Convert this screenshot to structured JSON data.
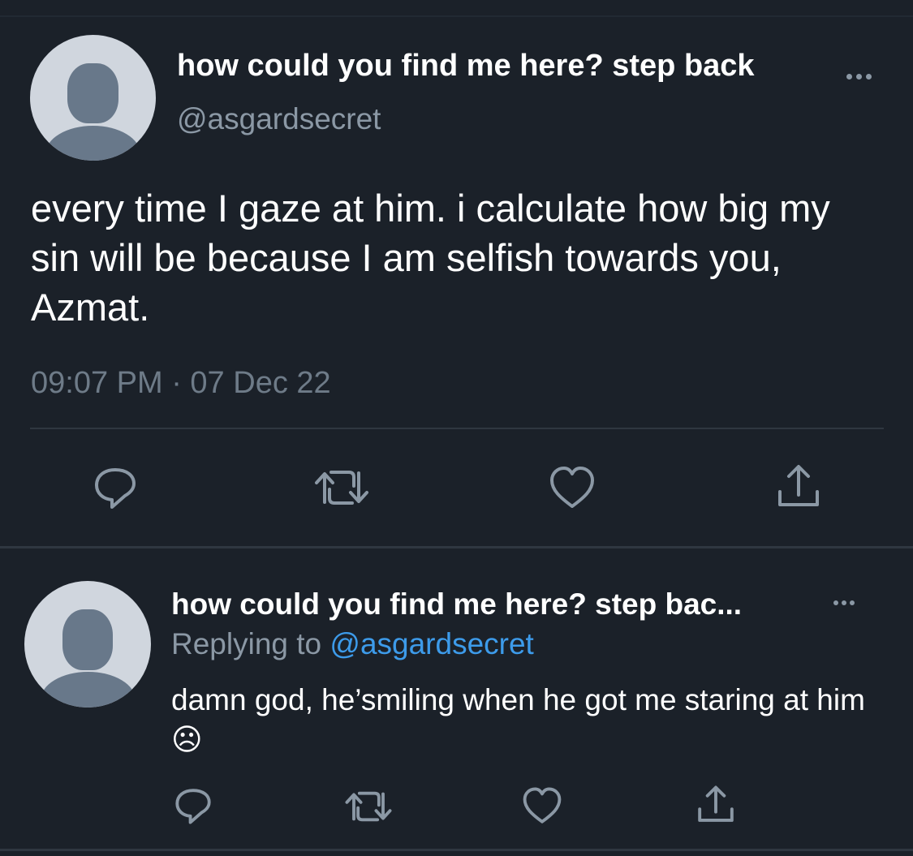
{
  "colors": {
    "background": "#1b2129",
    "text_primary": "#ffffff",
    "text_secondary": "#8b98a5",
    "link": "#3d9bea",
    "icon": "#8b98a5",
    "divider": "#2f3740"
  },
  "main_tweet": {
    "display_name": "how could you find me here? step back",
    "handle": "@asgardsecret",
    "text": "every time I gaze at him. i calculate how big my sin will be because I am selfish towards you, Azmat.",
    "timestamp": "09:07 PM · 07 Dec 22",
    "more_icon": "more-horizontal-icon",
    "actions": [
      "reply-icon",
      "retweet-icon",
      "like-icon",
      "share-icon"
    ]
  },
  "reply_tweet": {
    "display_name": "how could you find me here? step bac...",
    "replying_to_label": "Replying to",
    "replying_to_handle": "@asgardsecret",
    "text": "damn god, he’smiling when he got me staring at him☹",
    "more_icon": "more-horizontal-icon",
    "actions": [
      "reply-icon",
      "retweet-icon",
      "like-icon",
      "share-icon"
    ]
  }
}
